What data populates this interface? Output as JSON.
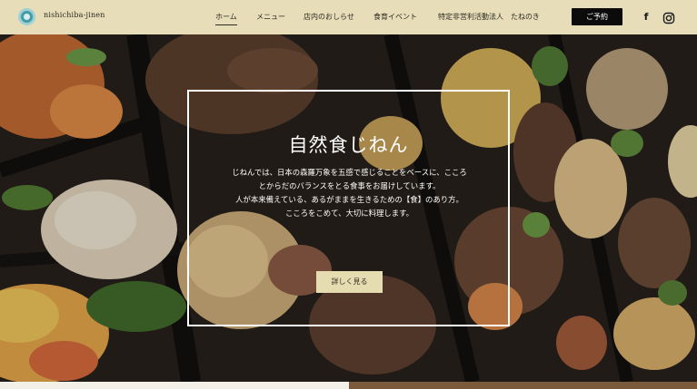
{
  "header": {
    "brand": "nishichiba-jinen",
    "nav": [
      "ホーム",
      "メニュー",
      "店内のおしらせ",
      "食育イベント",
      "特定非営利活動法人　たねのき"
    ],
    "reserve_label": "ご予約",
    "social": [
      "facebook-icon",
      "instagram-icon"
    ]
  },
  "hero": {
    "title": "自然食じねん",
    "body_lines": [
      "じねんでは、日本の森羅万象を五感で感じることをベースに、こころ",
      "とからだのバランスをとる食事をお届けしています。",
      "人が本来備えている、あるがままを生きるための【食】のあり方。",
      "こころをこめて、大切に料理します。"
    ],
    "button_label": "詳しく見る"
  },
  "colors": {
    "header_bg": "#e7ddb9",
    "button_bg": "#e6dcb2",
    "reserve_bg": "#0b0b0b"
  }
}
